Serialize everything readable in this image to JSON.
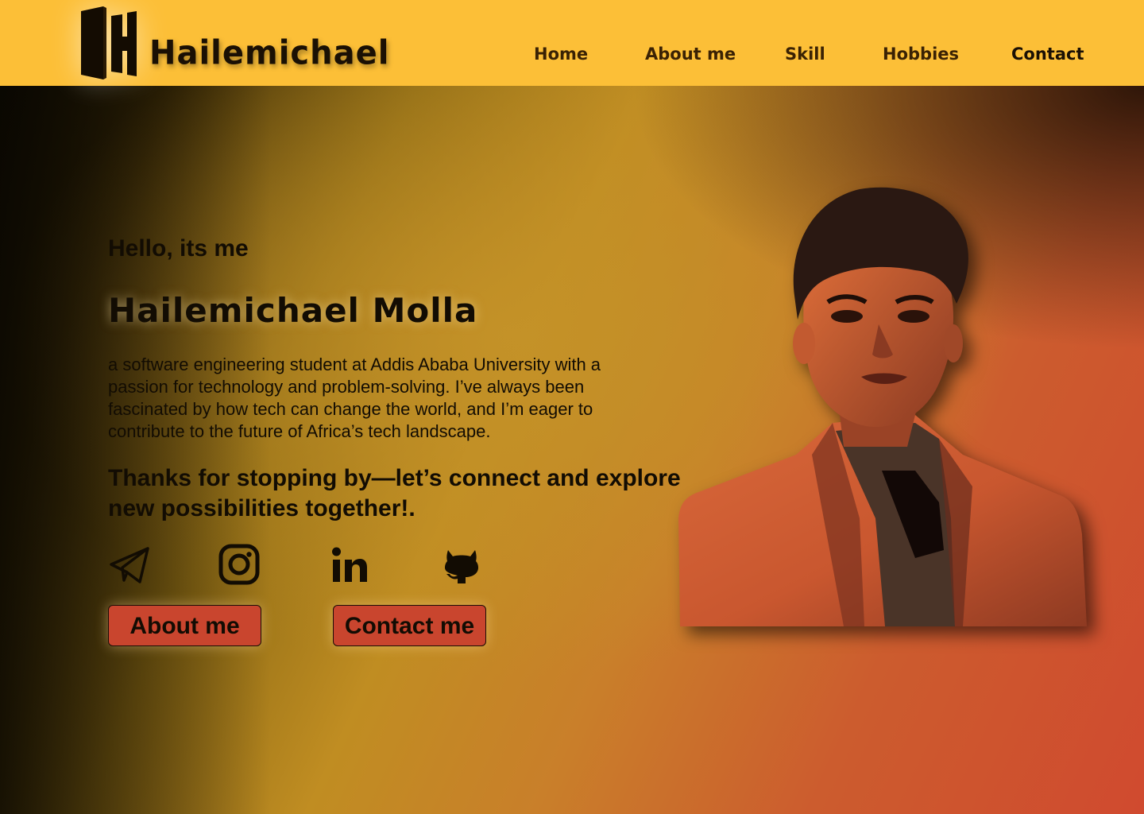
{
  "header": {
    "brand": "Hailemichael",
    "logo_letter": "H",
    "nav": [
      {
        "label": "Home"
      },
      {
        "label": "About me"
      },
      {
        "label": "Skill"
      },
      {
        "label": "Hobbies"
      },
      {
        "label": "Contact"
      }
    ]
  },
  "hero": {
    "greeting": "Hello, its me",
    "name": "Hailemichael Molla",
    "bio": "a software engineering student at Addis Ababa University with a passion for technology and problem-solving. I’ve always been fascinated by how tech can change the world, and I’m eager to contribute to the future of Africa’s tech landscape.",
    "thanks": "Thanks for stopping by—let’s connect and explore new possibilities together!.",
    "social": [
      {
        "icon": "telegram-icon"
      },
      {
        "icon": "instagram-icon"
      },
      {
        "icon": "linkedin-icon"
      },
      {
        "icon": "github-icon"
      }
    ],
    "buttons": {
      "about": "About me",
      "contact": "Contact me"
    }
  },
  "colors": {
    "header_bg": "#fcbf37",
    "button_bg": "#c9452e",
    "text": "#120c03"
  }
}
